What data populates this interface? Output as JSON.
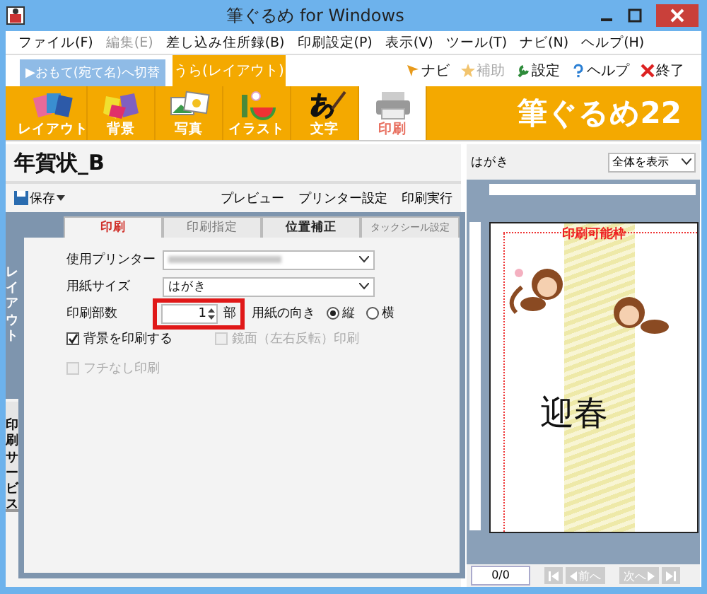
{
  "window": {
    "title": "筆ぐるめ for Windows"
  },
  "menu": [
    {
      "label": "ファイル(F)",
      "disabled": false
    },
    {
      "label": "編集(E)",
      "disabled": true
    },
    {
      "label": "差し込み住所録(B)",
      "disabled": false
    },
    {
      "label": "印刷設定(P)",
      "disabled": false
    },
    {
      "label": "表示(V)",
      "disabled": false
    },
    {
      "label": "ツール(T)",
      "disabled": false
    },
    {
      "label": "ナビ(N)",
      "disabled": false
    },
    {
      "label": "ヘルプ(H)",
      "disabled": false
    }
  ],
  "side_switch": [
    {
      "label": "▶おもて(宛て名)へ切替",
      "selected": false
    },
    {
      "label": "うら(レイアウト)",
      "selected": true
    }
  ],
  "quick_actions": [
    {
      "label": "ナビ",
      "kind": "navi",
      "disabled": false
    },
    {
      "label": "補助",
      "kind": "assist",
      "disabled": true
    },
    {
      "label": "設定",
      "kind": "settings",
      "disabled": false
    },
    {
      "label": "ヘルプ",
      "kind": "help",
      "disabled": false
    },
    {
      "label": "終了",
      "kind": "exit",
      "disabled": false
    }
  ],
  "toolbar": {
    "items": [
      {
        "label": "レイアウト",
        "kind": "layout",
        "selected": false
      },
      {
        "label": "背景",
        "kind": "background",
        "selected": false
      },
      {
        "label": "写真",
        "kind": "photo",
        "selected": false
      },
      {
        "label": "イラスト",
        "kind": "illust",
        "selected": false
      },
      {
        "label": "文字",
        "kind": "text",
        "selected": false
      },
      {
        "label": "印刷",
        "kind": "print",
        "selected": true
      }
    ],
    "logo": "筆ぐるめ22"
  },
  "document": {
    "title": "年賀状_B",
    "save": "保存",
    "actions": [
      "プレビュー",
      "プリンター設定",
      "印刷実行"
    ]
  },
  "side_tabs": [
    {
      "label": "レイアウト",
      "selected": true
    },
    {
      "label": "印刷サービス",
      "selected": false
    }
  ],
  "print_tabs": [
    {
      "label": "印刷",
      "selected": true
    },
    {
      "label": "印刷指定",
      "selected": false
    },
    {
      "label": "位置補正",
      "selected": false
    },
    {
      "label": "タックシール設定",
      "selected": false
    }
  ],
  "form": {
    "printer_label": "使用プリンター",
    "paper_label": "用紙サイズ",
    "paper_value": "はがき",
    "copies_label": "印刷部数",
    "copies_value": "1",
    "copies_unit": "部",
    "copies_highlighted": true,
    "orientation_label": "用紙の向き",
    "orientations": [
      {
        "label": "縦",
        "selected": true
      },
      {
        "label": "横",
        "selected": false
      }
    ],
    "options": [
      {
        "label": "背景を印刷する",
        "checked": true,
        "disabled": false
      },
      {
        "label": "鏡面（左右反転）印刷",
        "checked": false,
        "disabled": true
      },
      {
        "label": "フチなし印刷",
        "checked": false,
        "disabled": true
      }
    ]
  },
  "preview": {
    "paper": "はがき",
    "zoom": "全体を表示",
    "frame_label": "印刷可能枠",
    "greeting": "迎春",
    "page": "0/0",
    "nav": [
      {
        "label": "前へ",
        "kind": "prev"
      },
      {
        "label": "次へ",
        "kind": "next"
      }
    ]
  }
}
